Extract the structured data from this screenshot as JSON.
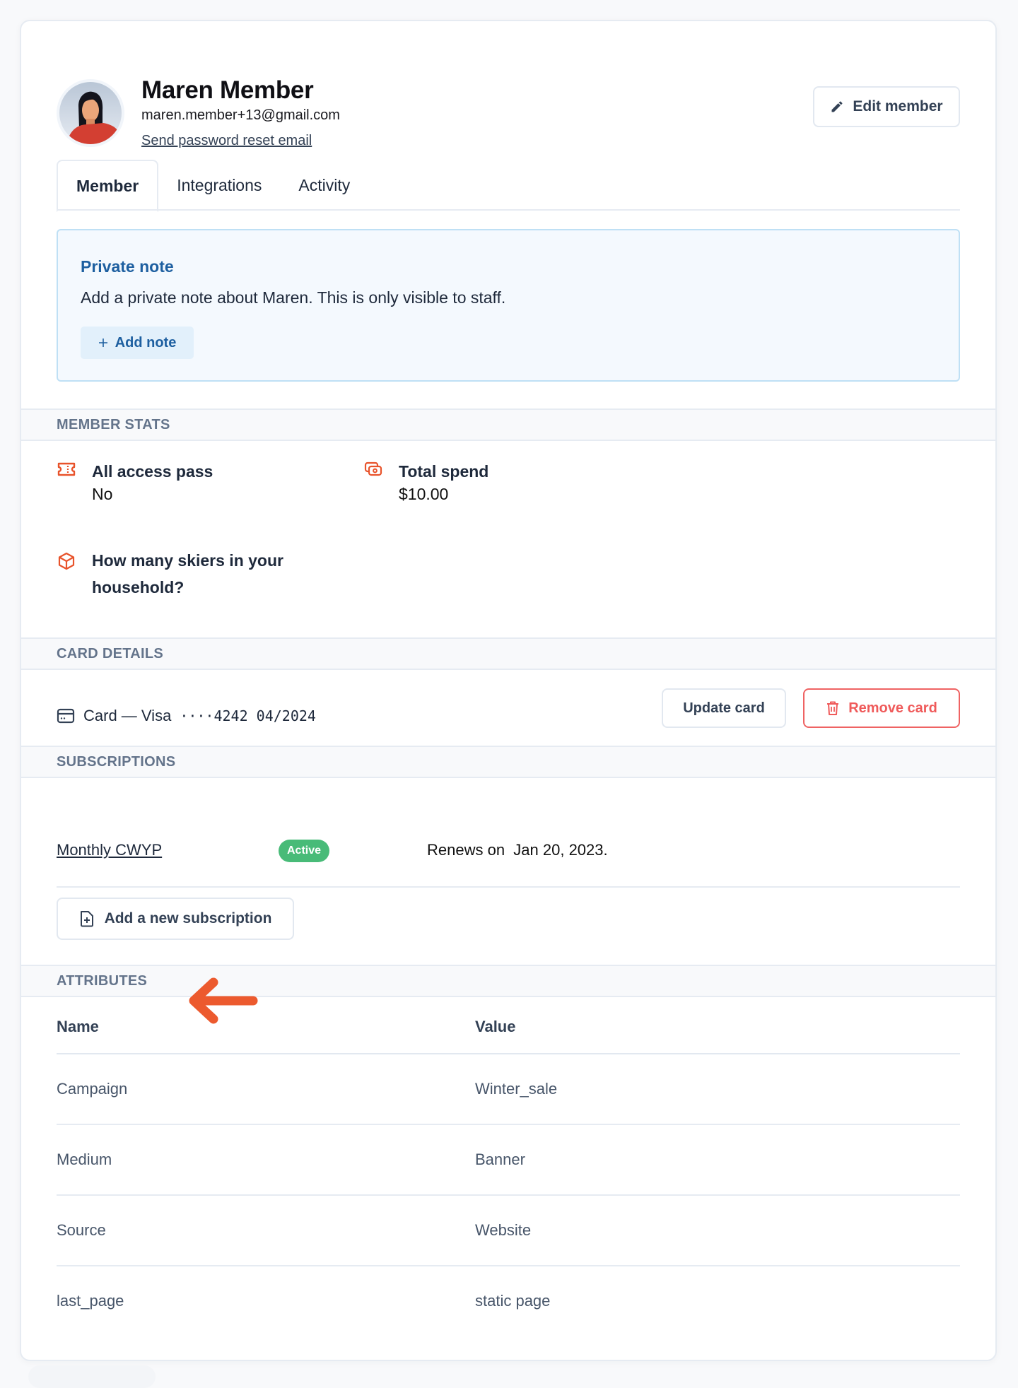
{
  "member": {
    "name": "Maren Member",
    "email": "maren.member+13@gmail.com",
    "reset_link": "Send password reset email",
    "edit_button": "Edit member"
  },
  "tabs": [
    {
      "label": "Member",
      "active": true
    },
    {
      "label": "Integrations",
      "active": false
    },
    {
      "label": "Activity",
      "active": false
    }
  ],
  "private_note": {
    "title": "Private note",
    "text": "Add a private note about Maren. This is only visible to staff.",
    "add_button": "Add note"
  },
  "sections": {
    "member_stats": "MEMBER STATS",
    "card_details": "CARD DETAILS",
    "subscriptions": "SUBSCRIPTIONS",
    "attributes": "ATTRIBUTES"
  },
  "stats": [
    {
      "icon": "ticket-icon",
      "label": "All access pass",
      "value": "No"
    },
    {
      "icon": "money-icon",
      "label": "Total spend",
      "value": "$10.00"
    },
    {
      "icon": "cube-icon",
      "label": "How many skiers in your household?",
      "value": ""
    }
  ],
  "card": {
    "label": "Card — Visa",
    "number": "····4242 04/2024",
    "update_button": "Update card",
    "remove_button": "Remove card"
  },
  "subscription": {
    "name": "Monthly CWYP",
    "status": "Active",
    "renews": "Renews on  Jan 20, 2023.",
    "add_button": "Add a new subscription"
  },
  "attributes": {
    "columns": [
      "Name",
      "Value"
    ],
    "rows": [
      {
        "name": "Campaign",
        "value": "Winter_sale"
      },
      {
        "name": "Medium",
        "value": "Banner"
      },
      {
        "name": "Source",
        "value": "Website"
      },
      {
        "name": "last_page",
        "value": "static page"
      }
    ]
  },
  "colors": {
    "accent_orange": "#e8532b",
    "link_blue": "#1d5fa0",
    "active_green": "#48bb78",
    "danger_red": "#ef5a5a",
    "annotation_arrow": "#ec5a2e"
  }
}
